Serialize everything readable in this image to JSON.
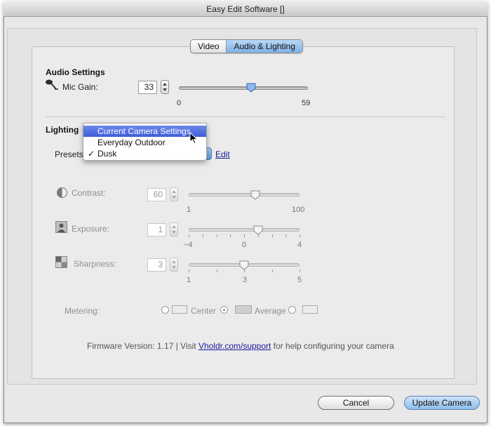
{
  "window": {
    "title": "Easy Edit Software []"
  },
  "tabs": [
    {
      "label": "Video",
      "active": false
    },
    {
      "label": "Audio & Lighting",
      "active": true
    }
  ],
  "audio": {
    "section_title": "Audio Settings",
    "mic_gain": {
      "label": "Mic Gain:",
      "value": "33",
      "min_label": "0",
      "max_label": "59",
      "fraction": 0.56,
      "icon": "microphone-icon"
    }
  },
  "lighting": {
    "section_title": "Lighting",
    "presets_label": "Presets:",
    "edit_link": "Edit",
    "menu": {
      "items": [
        {
          "label": "Current Camera Settings",
          "highlighted": true,
          "checked": false
        },
        {
          "label": "Everyday Outdoor",
          "highlighted": false,
          "checked": false
        },
        {
          "label": "Dusk",
          "highlighted": false,
          "checked": true
        }
      ],
      "check_glyph": "✓"
    },
    "contrast": {
      "label": "Contrast:",
      "value": "60",
      "min_label": "1",
      "max_label": "100",
      "fraction": 0.6,
      "icon": "contrast-icon"
    },
    "exposure": {
      "label": "Exposure:",
      "value": "1",
      "tick_labels": [
        "−4",
        "0",
        "4"
      ],
      "fraction": 0.625,
      "icon": "exposure-person-icon"
    },
    "sharpness": {
      "label": "Sharpness:",
      "value": "3",
      "tick_labels": [
        "1",
        "3",
        "5"
      ],
      "fraction": 0.5,
      "icon": "sharpness-icon"
    },
    "metering": {
      "label": "Metering:",
      "options": [
        {
          "label": "Center",
          "selected": false
        },
        {
          "label": "Average",
          "selected": true
        },
        {
          "label": "",
          "selected": false
        }
      ]
    }
  },
  "footer": {
    "firmware_prefix": "Firmware Version: 1.17 | Visit ",
    "support_link": "Vholdr.com/support",
    "firmware_suffix": " for help configuring your camera"
  },
  "buttons": {
    "cancel": "Cancel",
    "update": "Update Camera"
  },
  "colors": {
    "accent": "#5f98dc",
    "highlight": "#3d5ed8",
    "link": "#1a1a9a"
  }
}
